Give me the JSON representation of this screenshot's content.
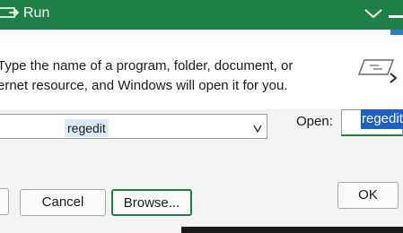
{
  "window": {
    "title": "Run",
    "accent": "#1e7f47",
    "selection": "#1e5fbf"
  },
  "icons": {
    "app": "run-app-icon",
    "chevron": "chevron-down-icon",
    "run": "run-dialog-icon",
    "arrow": "arrow-icon",
    "dropdown": "dropdown-arrow-icon"
  },
  "dialog": {
    "description_line1": "Type the name of a program, folder, document, or",
    "description_line2": "ernet resource, and Windows will open it for you."
  },
  "combo": {
    "value": "regedit"
  },
  "open": {
    "label": "Open:",
    "value": "regedit"
  },
  "buttons": {
    "ok": "OK",
    "cancel": "Cancel",
    "browse": "Browse..."
  }
}
